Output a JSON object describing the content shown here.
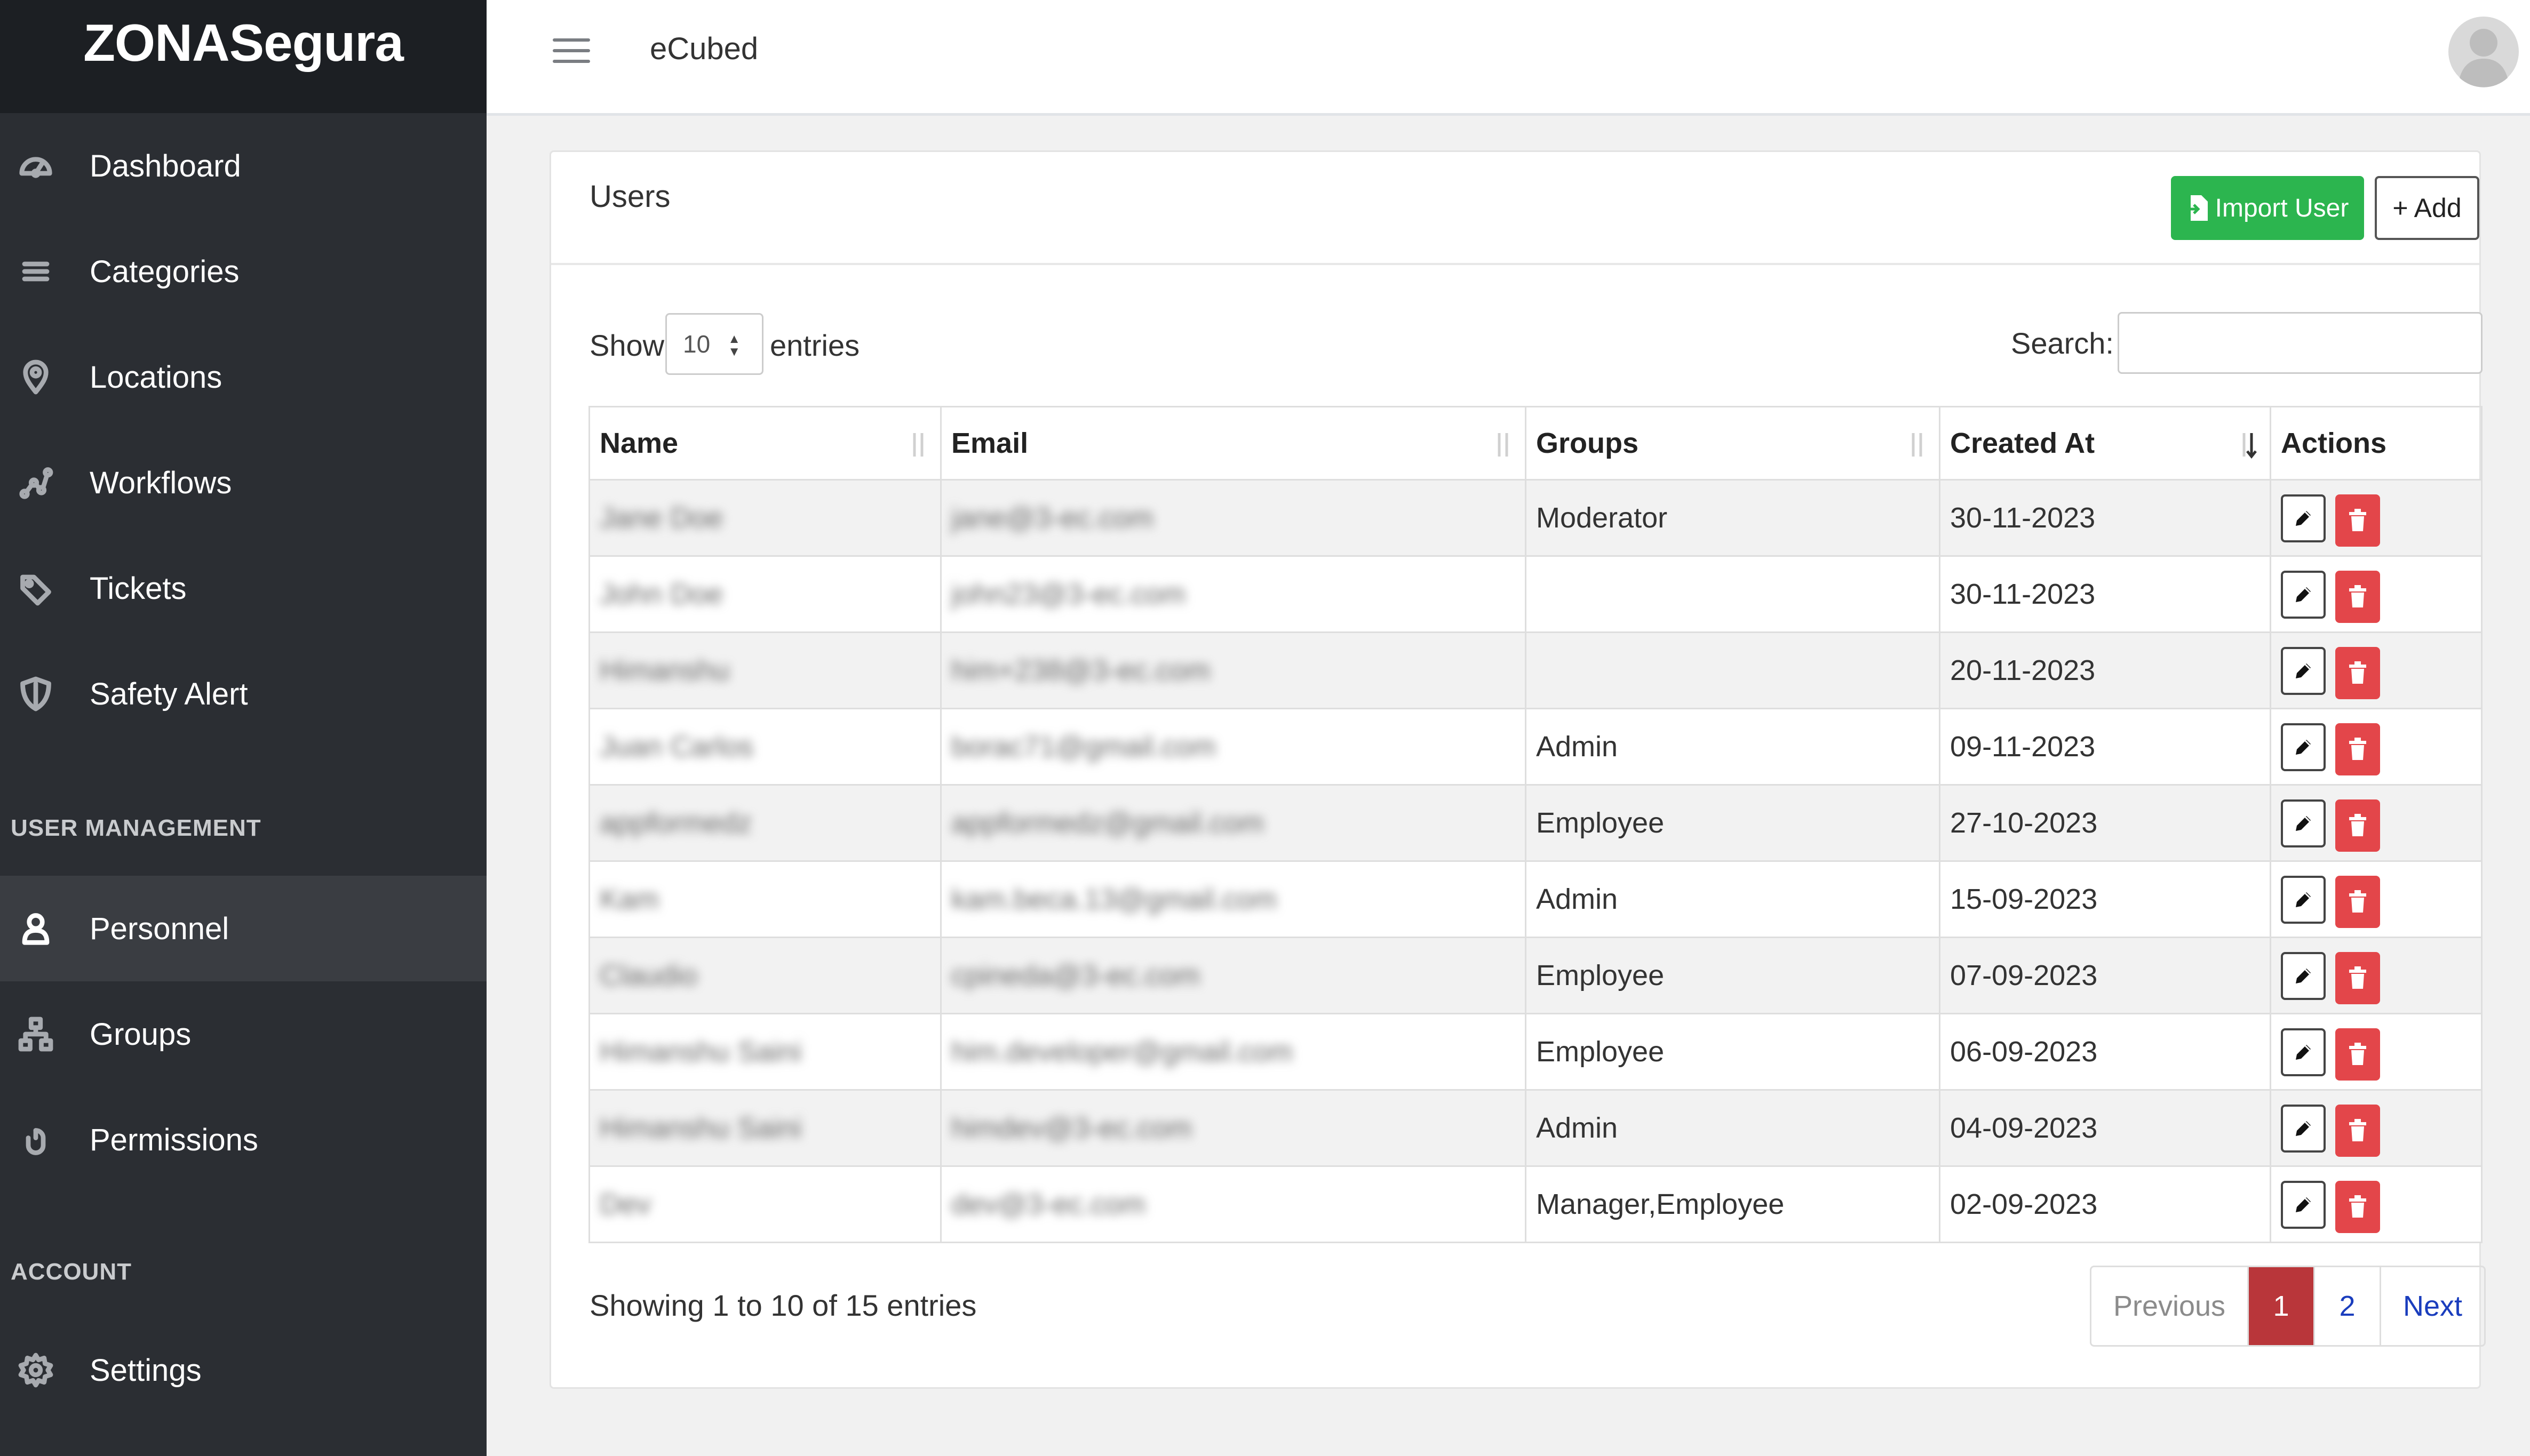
{
  "brand": "ZONASegura",
  "sidebar": {
    "items": [
      {
        "label": "Dashboard",
        "icon": "dashboard-icon"
      },
      {
        "label": "Categories",
        "icon": "list-icon"
      },
      {
        "label": "Locations",
        "icon": "location-pin-icon"
      },
      {
        "label": "Workflows",
        "icon": "workflow-icon"
      },
      {
        "label": "Tickets",
        "icon": "tag-icon"
      },
      {
        "label": "Safety Alert",
        "icon": "shield-icon"
      }
    ],
    "section_user_management": "USER MANAGEMENT",
    "user_items": [
      {
        "label": "Personnel",
        "icon": "person-icon",
        "active": true
      },
      {
        "label": "Groups",
        "icon": "groups-icon"
      },
      {
        "label": "Permissions",
        "icon": "mouse-icon"
      }
    ],
    "section_account": "ACCOUNT",
    "account_items": [
      {
        "label": "Settings",
        "icon": "gear-icon"
      }
    ]
  },
  "topbar": {
    "title": "eCubed",
    "menu_icon": "hamburger-icon",
    "avatar_icon": "user-avatar-icon"
  },
  "card": {
    "title": "Users",
    "import_label": "Import User",
    "add_label": "+ Add"
  },
  "table_controls": {
    "show_label": "Show",
    "page_length": "10",
    "entries_label": "entries",
    "search_label": "Search:",
    "search_value": ""
  },
  "table": {
    "columns": [
      "Name",
      "Email",
      "Groups",
      "Created At",
      "Actions"
    ],
    "rows": [
      {
        "name": "Jane Doe",
        "email": "jane@3-ec.com",
        "groups": "Moderator",
        "created_at": "30-11-2023"
      },
      {
        "name": "John Doe",
        "email": "john23@3-ec.com",
        "groups": "",
        "created_at": "30-11-2023"
      },
      {
        "name": "Himanshu",
        "email": "him+238@3-ec.com",
        "groups": "",
        "created_at": "20-11-2023"
      },
      {
        "name": "Juan Carlos",
        "email": "borac71@gmail.com",
        "groups": "Admin",
        "created_at": "09-11-2023"
      },
      {
        "name": "appformedz",
        "email": "appformedz@gmail.com",
        "groups": "Employee",
        "created_at": "27-10-2023"
      },
      {
        "name": "Kam",
        "email": "kam.beca.13@gmail.com",
        "groups": "Admin",
        "created_at": "15-09-2023"
      },
      {
        "name": "Claudio",
        "email": "cpineda@3-ec.com",
        "groups": "Employee",
        "created_at": "07-09-2023"
      },
      {
        "name": "Himanshu Saini",
        "email": "him.developer@gmail.com",
        "groups": "Employee",
        "created_at": "06-09-2023"
      },
      {
        "name": "Himanshu Saini",
        "email": "himdev@3-ec.com",
        "groups": "Admin",
        "created_at": "04-09-2023"
      },
      {
        "name": "Dev",
        "email": "dev@3-ec.com",
        "groups": "Manager,Employee",
        "created_at": "02-09-2023"
      }
    ]
  },
  "footer": {
    "info": "Showing 1 to 10 of 15 entries",
    "prev_label": "Previous",
    "pages": [
      "1",
      "2"
    ],
    "current_page": "1",
    "next_label": "Next"
  },
  "colors": {
    "sidebar_bg": "#2b2e33",
    "brand_bg": "#1c1f23",
    "import_green": "#2cb54f",
    "delete_red": "#e3464a",
    "active_page": "#b9363a",
    "link_blue": "#1a3dbd"
  }
}
